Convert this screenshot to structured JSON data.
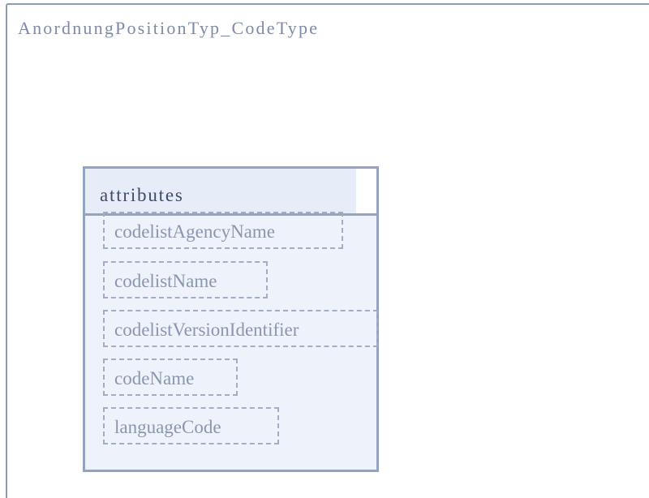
{
  "type_name": "AnordnungPositionTyp_CodeType",
  "attributes_group": {
    "label": "attributes",
    "items": [
      "codelistAgencyName",
      "codelistName",
      "codelistVersionIdentifier",
      "codeName",
      "languageCode"
    ]
  },
  "colors": {
    "border": "#94a3c0",
    "box_fill": "#eef2fb",
    "title_text": "#7f8aa6",
    "label_text": "#3d4a6b",
    "item_text": "#8a96b0"
  }
}
